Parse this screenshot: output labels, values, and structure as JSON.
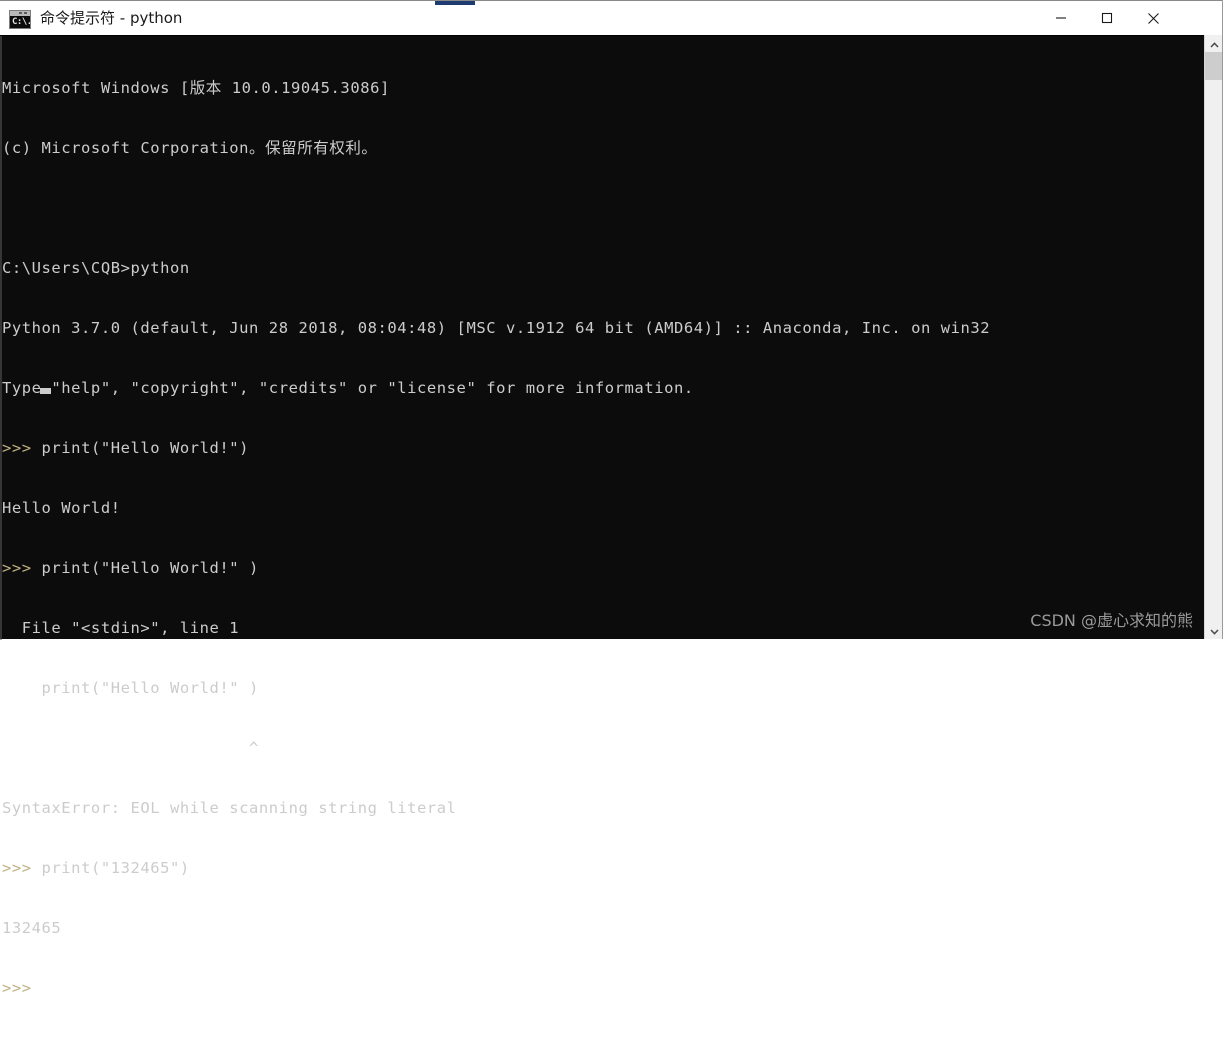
{
  "window": {
    "title": "命令提示符 - python",
    "icon": "cmd-icon",
    "icon_text": "C:\\.",
    "controls": {
      "minimize": "minimize-icon",
      "maximize": "maximize-icon",
      "close": "close-icon"
    },
    "colors": {
      "console_background": "#0c0c0c",
      "console_text": "#cccccc",
      "prompt_text": "#c0b283",
      "titlebar_background": "#ffffff",
      "title_text": "#1a1a1a",
      "watermark_text": "#9a9a9a",
      "scrollbar_track": "#f0f0f0",
      "scrollbar_thumb": "#cdcdcd",
      "accent_strip": "#1f3c72"
    }
  },
  "console": {
    "lines": [
      "Microsoft Windows [版本 10.0.19045.3086]",
      "(c) Microsoft Corporation。保留所有权利。",
      "",
      "C:\\Users\\CQB>python",
      "Python 3.7.0 (default, Jun 28 2018, 08:04:48) [MSC v.1912 64 bit (AMD64)] :: Anaconda, Inc. on win32",
      "Type \"help\", \"copyright\", \"credits\" or \"license\" for more information.",
      ">>> print(\"Hello World!\")",
      "Hello World!",
      ">>> print(\"Hello World!\" )",
      "  File \"<stdin>\", line 1",
      "    print(\"Hello World!\" )",
      "                         ^",
      "SyntaxError: EOL while scanning string literal",
      ">>> print(\"132465\")",
      "132465",
      ">>> "
    ],
    "cursor": "block-cursor",
    "cursor_line": 15,
    "cursor_column": 4
  },
  "watermark": {
    "text": "CSDN @虚心求知的熊"
  },
  "scrollbar": {
    "up_arrow": "chevron-up-icon",
    "down_arrow": "chevron-down-icon",
    "thumb": "scrollbar-thumb"
  }
}
